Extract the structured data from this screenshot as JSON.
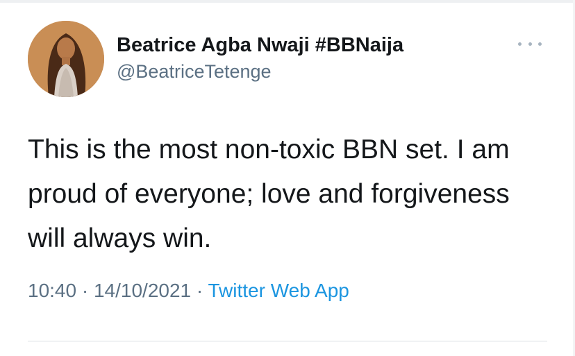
{
  "tweet": {
    "author": {
      "display_name": "Beatrice Agba Nwaji #BBNaija",
      "handle": "@BeatriceTetenge",
      "avatar_icon": "profile-photo"
    },
    "text": "This is the most non-toxic BBN set. I am proud of everyone; love and forgiveness will always win.",
    "time": "10:40",
    "separator": "·",
    "date": "14/10/2021",
    "source": "Twitter Web App",
    "more_icon": "more-options-icon"
  },
  "colors": {
    "text_primary": "#14171a",
    "text_secondary": "#5b7083",
    "link": "#1b95e0",
    "divider": "#d9dee2"
  }
}
